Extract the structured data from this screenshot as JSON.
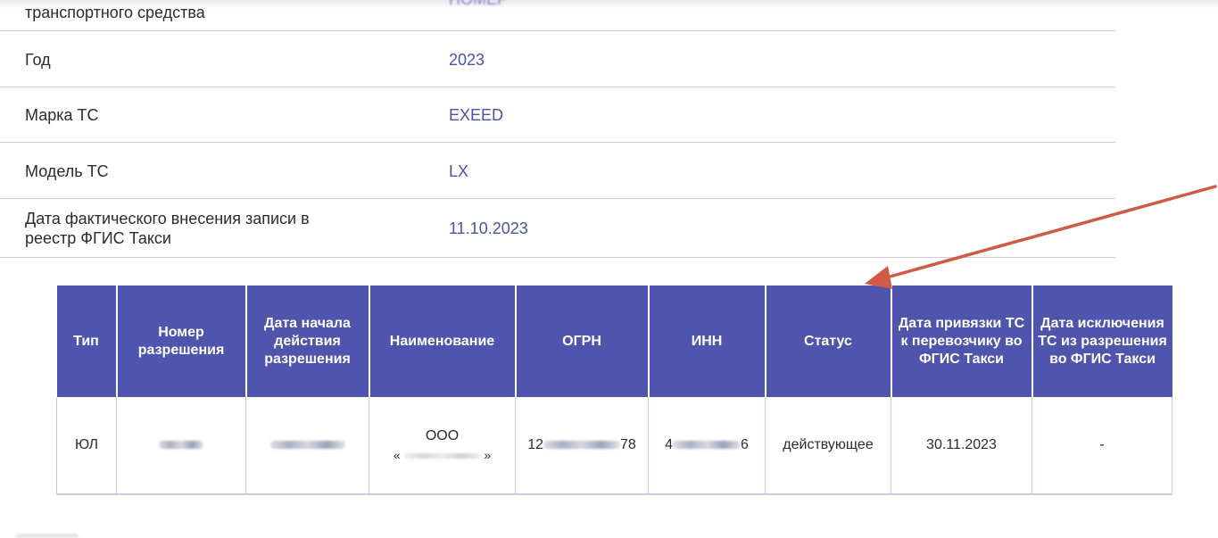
{
  "info_rows": [
    {
      "label": "транспортного средства",
      "value": "НОМЕР"
    },
    {
      "label": "Год",
      "value": "2023"
    },
    {
      "label": "Марка ТС",
      "value": "EXEED"
    },
    {
      "label": "Модель ТС",
      "value": "LX"
    },
    {
      "label": "Дата фактического внесения записи в реестр ФГИС Такси",
      "value": "11.10.2023"
    }
  ],
  "permit_table": {
    "headers": [
      "Тип",
      "Номер разрешения",
      "Дата начала действия разрешения",
      "Наименование",
      "ОГРН",
      "ИНН",
      "Статус",
      "Дата привязки ТС к перевозчику во ФГИС Такси",
      "Дата исключения ТС из разрешения во ФГИС Такси"
    ],
    "row": {
      "type": "ЮЛ",
      "name_prefix": "ООО",
      "name_open_quote": "«",
      "name_close_quote": "»",
      "ogrn_start": "12",
      "ogrn_end": "78",
      "inn_start": "4",
      "inn_end": "6",
      "status": "действующее",
      "link_date": "30.11.2023",
      "exclusion_date": "-"
    }
  },
  "colors": {
    "header_bg": "#4f55ad",
    "value_text": "#4a53a8",
    "arrow": "#d05a45",
    "row_border": "#c9cbe6"
  }
}
